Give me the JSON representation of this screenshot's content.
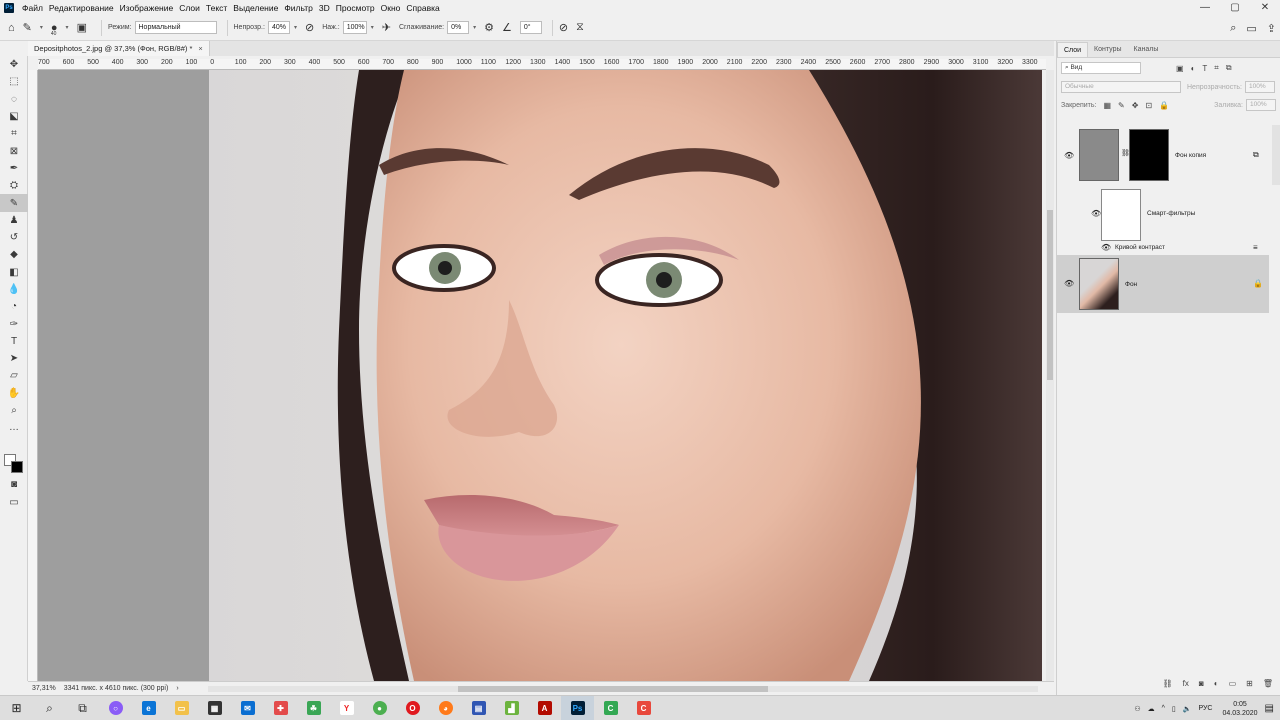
{
  "menu": {
    "logo": "Ps",
    "items": [
      "Файл",
      "Редактирование",
      "Изображение",
      "Слои",
      "Текст",
      "Выделение",
      "Фильтр",
      "3D",
      "Просмотр",
      "Окно",
      "Справка"
    ]
  },
  "window_controls": {
    "minimize": "—",
    "maximize": "▢",
    "close": "✕"
  },
  "options_bar": {
    "brush_size": "40",
    "mode_label": "Режим:",
    "mode_value": "Нормальный",
    "opacity_label": "Непрозр.:",
    "opacity_value": "40%",
    "flow_label": "Наж.:",
    "flow_value": "100%",
    "smoothing_label": "Сглаживание:",
    "smoothing_value": "0%",
    "angle_value": "0°"
  },
  "document": {
    "tab_title": "Depositphotos_2.jpg @ 37,3% (Фон, RGB/8#) *",
    "zoom": "37,31%",
    "size_info": "3341 пикс. x 4610 пикс. (300 ppi)"
  },
  "ruler_ticks": [
    "700",
    "600",
    "500",
    "400",
    "300",
    "200",
    "100",
    "0",
    "100",
    "200",
    "300",
    "400",
    "500",
    "600",
    "700",
    "800",
    "900",
    "1000",
    "1100",
    "1200",
    "1300",
    "1400",
    "1500",
    "1600",
    "1700",
    "1800",
    "1900",
    "2000",
    "2100",
    "2200",
    "2300",
    "2400",
    "2500",
    "2600",
    "2700",
    "2800",
    "2900",
    "3000",
    "3100",
    "3200",
    "3300"
  ],
  "panel": {
    "tabs": [
      "Слои",
      "Контуры",
      "Каналы"
    ],
    "active_tab": "Слои",
    "filter_kind": "Вид",
    "blend_mode": "Обычные",
    "opacity_label": "Непрозрачность:",
    "opacity_value": "100%",
    "lock_label": "Закрепить:",
    "fill_label": "Заливка:",
    "fill_value": "100%",
    "layers": {
      "copy_name": "Фон копия",
      "smart_filters": "Смарт-фильтры",
      "filter_name": "Кривой контраст",
      "background_name": "Фон"
    }
  },
  "taskbar": {
    "lang": "РУС",
    "time": "0:05",
    "date": "04.03.2020"
  },
  "colors": {
    "foreground": "#ffffff",
    "background": "#000000",
    "ps_accent": "#31a8ff"
  }
}
